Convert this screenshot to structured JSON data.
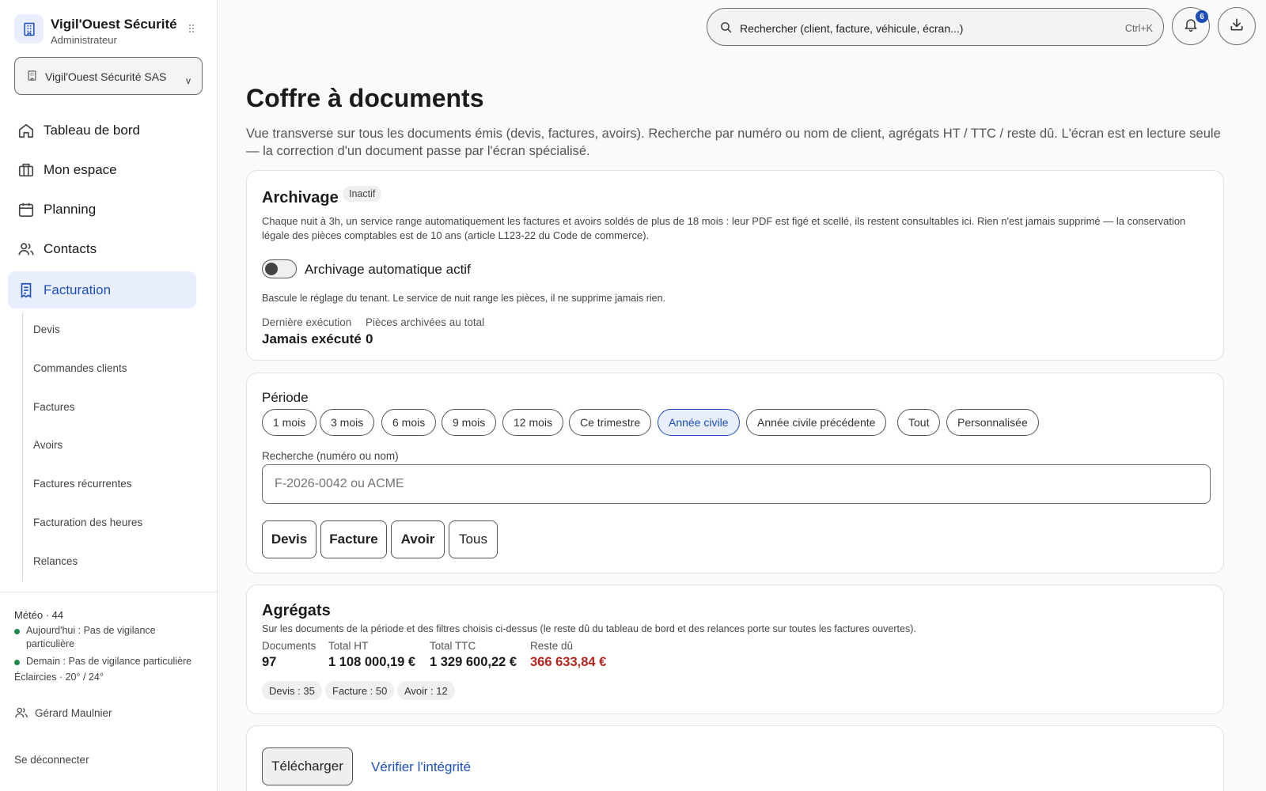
{
  "brand": {
    "name": "Vigil'Ouest Sécurité",
    "role": "Administrateur"
  },
  "tenant": {
    "label": "Vigil'Ouest Sécurité SAS",
    "caret": "v"
  },
  "nav": [
    {
      "label": "Tableau de bord",
      "icon": "home-icon"
    },
    {
      "label": "Mon espace",
      "icon": "building-icon"
    },
    {
      "label": "Planning",
      "icon": "calendar-icon"
    },
    {
      "label": "Contacts",
      "icon": "users-icon"
    },
    {
      "label": "Facturation",
      "icon": "receipt-icon"
    }
  ],
  "subnav": [
    "Devis",
    "Commandes clients",
    "Factures",
    "Avoirs",
    "Factures récurrentes",
    "Facturation des heures",
    "Relances"
  ],
  "weather": {
    "title": "Météo · 44",
    "today": "Aujourd'hui : Pas de vigilance particulière",
    "tomorrow": "Demain : Pas de vigilance particulière",
    "sky": "Éclaircies · 20° / 24°"
  },
  "user": {
    "name": "Gérard Maulnier"
  },
  "logout": "Se déconnecter",
  "search": {
    "placeholder": "Rechercher (client, facture, véhicule, écran...)",
    "shortcut": "Ctrl+K"
  },
  "notifications": {
    "count": "6"
  },
  "page": {
    "title": "Coffre à documents",
    "description": "Vue transverse sur tous les documents émis (devis, factures, avoirs). Recherche par numéro ou nom de client, agrégats HT / TTC / reste dû. L'écran est en lecture seule — la correction d'un document passe par l'écran spécialisé."
  },
  "archivage": {
    "title": "Archivage",
    "status": "Inactif",
    "description": "Chaque nuit à 3h, un service range automatiquement les factures et avoirs soldés de plus de 18 mois : leur PDF est figé et scellé, ils restent consultables ici. Rien n'est jamais supprimé — la conservation légale des pièces comptables est de 10 ans (article L123-22 du Code de commerce).",
    "toggle_label": "Archivage automatique actif",
    "toggle_hint": "Bascule le réglage du tenant. Le service de nuit range les pièces, il ne supprime jamais rien.",
    "last_run_label": "Dernière exécution",
    "last_run_value": "Jamais exécuté",
    "archived_label": "Pièces archivées au total",
    "archived_value": "0"
  },
  "filters": {
    "period_label": "Période",
    "periods": [
      "1 mois",
      "3 mois",
      "6 mois",
      "9 mois",
      "12 mois",
      "Ce trimestre",
      "Année civile",
      "Année civile précédente",
      "Tout",
      "Personnalisée"
    ],
    "selected_period": "Année civile",
    "search_label": "Recherche (numéro ou nom)",
    "search_placeholder": "F-2026-0042 ou ACME",
    "types": [
      "Devis",
      "Facture",
      "Avoir",
      "Tous"
    ]
  },
  "aggregates": {
    "title": "Agrégats",
    "description": "Sur les documents de la période et des filtres choisis ci-dessus (le reste dû du tableau de bord et des relances porte sur toutes les factures ouvertes).",
    "documents_label": "Documents",
    "documents_value": "97",
    "ht_label": "Total HT",
    "ht_value": "1 108 000,19 €",
    "ttc_label": "Total TTC",
    "ttc_value": "1 329 600,22 €",
    "due_label": "Reste dû",
    "due_value": "366 633,84 €",
    "due_color": "#b3261e",
    "counts": [
      "Devis : 35",
      "Facture : 50",
      "Avoir : 12"
    ]
  },
  "actions": {
    "download": "Télécharger",
    "verify": "Vérifier l'intégrité"
  },
  "colors": {
    "accent": "#1d4fb8",
    "active_bg": "#e8eefc"
  }
}
